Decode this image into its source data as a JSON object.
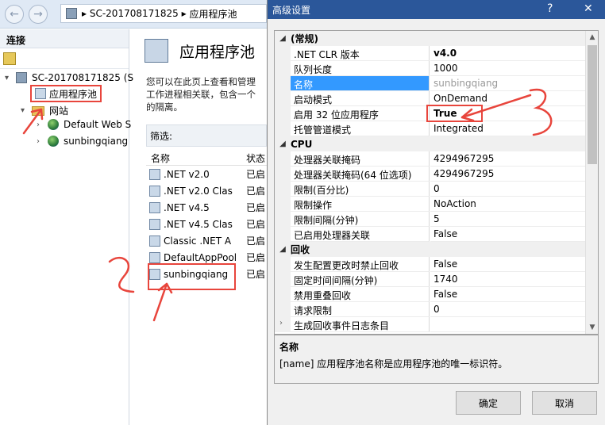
{
  "iis": {
    "breadcrumb": [
      "SC-201708171825",
      "应用程序池"
    ],
    "connections": {
      "header": "连接",
      "tree": {
        "server": "SC-201708171825 (S",
        "app_pools": "应用程序池",
        "sites": "网站",
        "site_items": [
          "Default Web S",
          "sunbingqiang"
        ]
      }
    },
    "main": {
      "title": "应用程序池",
      "desc": "您可以在此页上查看和管理 工作进程相关联，包含一个 的隔离。",
      "filter_label": "筛选:",
      "col_name": "名称",
      "col_status": "状态",
      "pools": [
        {
          "name": ".NET v2.0",
          "status": "已启"
        },
        {
          "name": ".NET v2.0 Clas",
          "status": "已启"
        },
        {
          "name": ".NET v4.5",
          "status": "已启"
        },
        {
          "name": ".NET v4.5 Clas",
          "status": "已启"
        },
        {
          "name": "Classic .NET A",
          "status": "已启"
        },
        {
          "name": "DefaultAppPool",
          "status": "已启"
        },
        {
          "name": "sunbingqiang",
          "status": "已启"
        }
      ]
    }
  },
  "dialog": {
    "title": "高级设置",
    "help": "?",
    "close": "✕",
    "categories": {
      "general": "(常规)",
      "cpu": "CPU",
      "recycle": "回收"
    },
    "general": [
      {
        "name": ".NET CLR 版本",
        "value": "v4.0"
      },
      {
        "name": "队列长度",
        "value": "1000"
      },
      {
        "name": "名称",
        "value": "sunbingqiang"
      },
      {
        "name": "启动模式",
        "value": "OnDemand"
      },
      {
        "name": "启用 32 位应用程序",
        "value": "True"
      },
      {
        "name": "托管管道模式",
        "value": "Integrated"
      }
    ],
    "cpu": [
      {
        "name": "处理器关联掩码",
        "value": "4294967295"
      },
      {
        "name": "处理器关联掩码(64 位选项)",
        "value": "4294967295"
      },
      {
        "name": "限制(百分比)",
        "value": "0"
      },
      {
        "name": "限制操作",
        "value": "NoAction"
      },
      {
        "name": "限制间隔(分钟)",
        "value": "5"
      },
      {
        "name": "已启用处理器关联",
        "value": "False"
      }
    ],
    "recycle": [
      {
        "name": "发生配置更改时禁止回收",
        "value": "False"
      },
      {
        "name": "固定时间间隔(分钟)",
        "value": "1740"
      },
      {
        "name": "禁用重叠回收",
        "value": "False"
      },
      {
        "name": "请求限制",
        "value": "0"
      },
      {
        "name": "生成回收事件日志条目",
        "value": ""
      }
    ],
    "description": {
      "title": "名称",
      "text": "[name] 应用程序池名称是应用程序池的唯一标识符。"
    },
    "ok_label": "确定",
    "cancel_label": "取消"
  },
  "annotations": [
    "2",
    "3"
  ],
  "colors": {
    "accent": "#2b579a",
    "selection": "#3399ff",
    "annotation": "#e8453c"
  }
}
